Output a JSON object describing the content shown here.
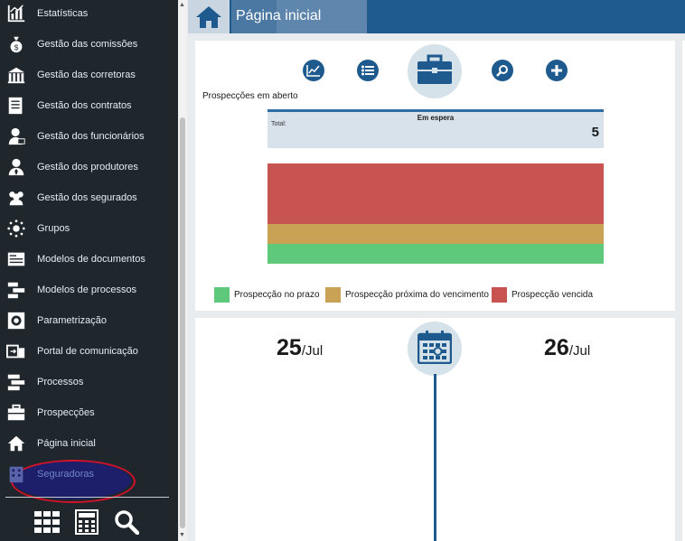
{
  "sidebar": {
    "items": [
      {
        "label": "Estatísticas",
        "icon": "bar-chart-icon"
      },
      {
        "label": "Gestão das comissões",
        "icon": "money-bag-icon"
      },
      {
        "label": "Gestão das corretoras",
        "icon": "building-columns-icon"
      },
      {
        "label": "Gestão dos contratos",
        "icon": "contract-document-icon"
      },
      {
        "label": "Gestão dos funcionários",
        "icon": "employee-icon"
      },
      {
        "label": "Gestão dos produtores",
        "icon": "producer-icon"
      },
      {
        "label": "Gestão dos segurados",
        "icon": "users-group-icon"
      },
      {
        "label": "Grupos",
        "icon": "network-groups-icon"
      },
      {
        "label": "Modelos de documentos",
        "icon": "document-template-icon"
      },
      {
        "label": "Modelos de processos",
        "icon": "process-template-icon"
      },
      {
        "label": "Parametrização",
        "icon": "settings-gear-icon"
      },
      {
        "label": "Portal de comunicação",
        "icon": "communication-portal-icon"
      },
      {
        "label": "Processos",
        "icon": "processes-icon"
      },
      {
        "label": "Prospecções",
        "icon": "briefcase-icon"
      },
      {
        "label": "Página inicial",
        "icon": "home-icon"
      },
      {
        "label": "Seguradoras",
        "icon": "insurer-building-icon",
        "selected": true
      }
    ],
    "bottom_tools": [
      "apps-grid-icon",
      "calculator-icon",
      "search-icon"
    ]
  },
  "header": {
    "title": "Página inicial",
    "icon": "home-icon"
  },
  "prospections": {
    "toolbar": [
      "chart-icon",
      "list-icon",
      "briefcase-icon",
      "search-icon",
      "add-icon"
    ],
    "section_title": "Prospecções em aberto",
    "status": {
      "name": "Em espera",
      "total_label": "Total:",
      "total_value": "5"
    },
    "legend": [
      {
        "label": "Prospecção no prazo",
        "color": "#5ec97b"
      },
      {
        "label": "Prospecção próxima do vencimento",
        "color": "#c9a255"
      },
      {
        "label": "Prospecção vencida",
        "color": "#c75450"
      }
    ],
    "bar_fractions": [
      0.6,
      0.2,
      0.2
    ]
  },
  "calendar": {
    "dates": [
      {
        "day": "25",
        "month": "/Jul"
      },
      {
        "day": "26",
        "month": "/Jul"
      }
    ]
  }
}
